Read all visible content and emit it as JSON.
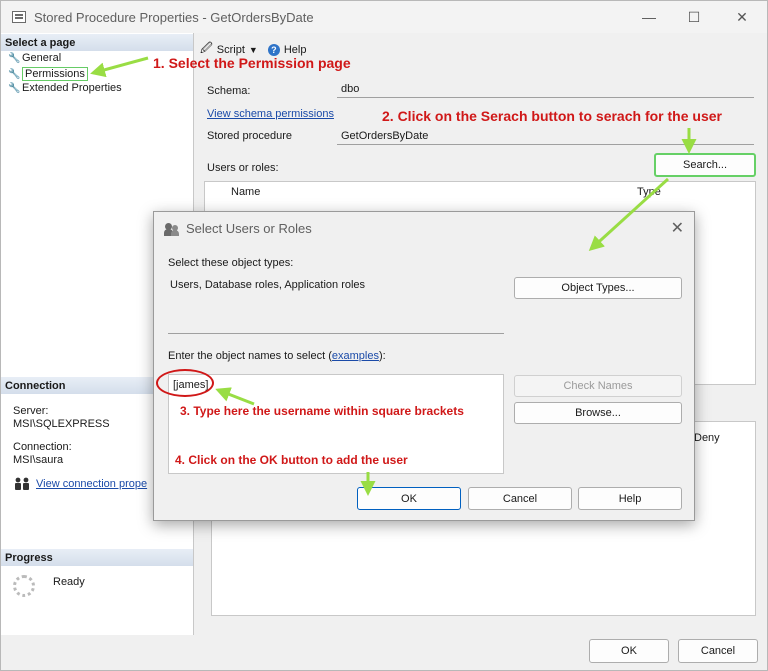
{
  "window": {
    "title": "Stored Procedure Properties - GetOrdersByDate",
    "minimize_glyph": "—",
    "maximize_glyph": "☐",
    "close_glyph": "✕"
  },
  "left_pane": {
    "select_page_header": "Select a page",
    "pages": [
      {
        "label": "General",
        "icon": "wrench-icon"
      },
      {
        "label": "Permissions",
        "icon": "wrench-icon",
        "selected": true
      },
      {
        "label": "Extended Properties",
        "icon": "wrench-icon"
      }
    ],
    "connection_header": "Connection",
    "server_label": "Server:",
    "server_value": "MSI\\SQLEXPRESS",
    "connection_label": "Connection:",
    "connection_value": "MSI\\saura",
    "view_connection_link": "View connection prope",
    "progress_header": "Progress",
    "progress_status": "Ready"
  },
  "toolbar": {
    "script_label": "Script",
    "help_label": "Help"
  },
  "form": {
    "schema_label": "Schema:",
    "schema_value": "dbo",
    "view_schema_permissions": "View schema permissions",
    "stored_procedure_label": "Stored procedure",
    "stored_procedure_value": "GetOrdersByDate",
    "users_or_roles_label": "Users or roles:",
    "search_button": "Search...",
    "grid_columns": [
      "Name",
      "Type"
    ],
    "perm_column_deny": "Deny"
  },
  "dialog": {
    "title": "Select Users or Roles",
    "object_types_label": "Select these object types:",
    "object_types_value": "Users, Database roles, Application roles",
    "object_types_button": "Object Types...",
    "enter_names_prefix": "Enter the object names to select (",
    "examples_link": "examples",
    "enter_names_suffix": "):",
    "names_value": "[james]",
    "check_names_button": "Check Names",
    "browse_button": "Browse...",
    "ok_button": "OK",
    "cancel_button": "Cancel",
    "help_button": "Help"
  },
  "annotations": {
    "step1": "1. Select the Permission page",
    "step2": "2. Click on the Serach button to serach for the user",
    "step3": "3. Type here the username within square brackets",
    "step4": "4. Click on the OK button to add the user",
    "arrow_color": "#99dd44",
    "text_color": "#d01818"
  },
  "bottom": {
    "ok_button": "OK",
    "cancel_button": "Cancel"
  }
}
